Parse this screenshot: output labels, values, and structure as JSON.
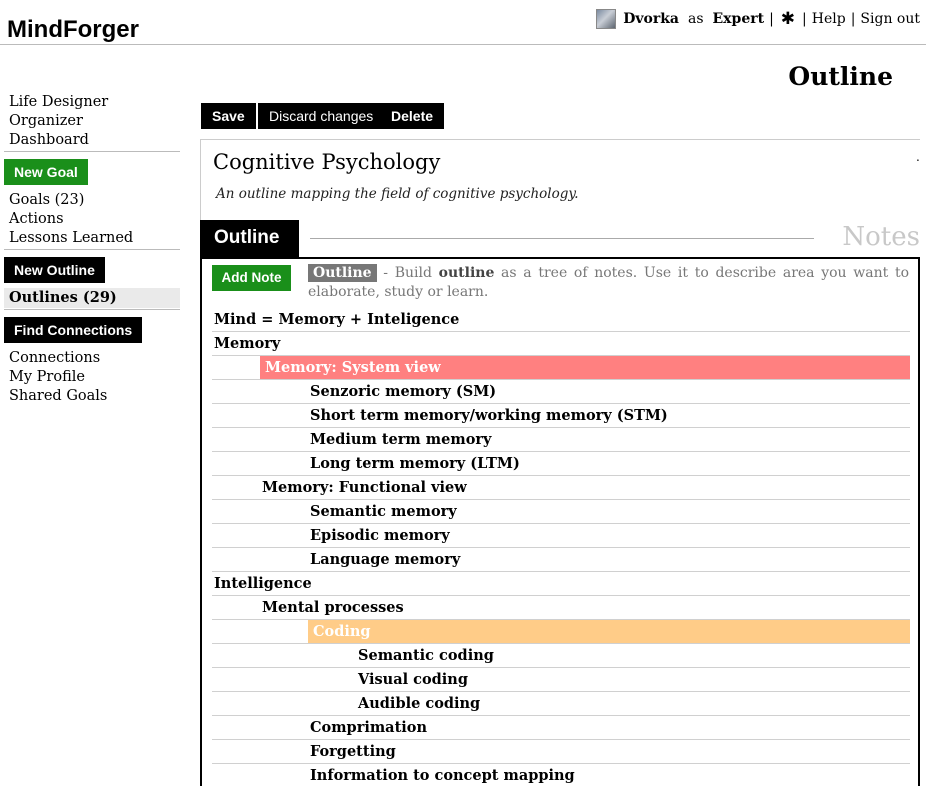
{
  "topbar": {
    "user": "Dvorka",
    "as_word": "as",
    "role": "Expert",
    "help": "Help",
    "signout": "Sign out"
  },
  "brand": "MindForger",
  "nav_top": [
    "Life Designer",
    "Organizer",
    "Dashboard"
  ],
  "new_goal": "New Goal",
  "nav_goals": [
    "Goals (23)",
    "Actions",
    "Lessons Learned"
  ],
  "new_outline": "New Outline",
  "outlines_selected": "Outlines (29)",
  "find_connections": "Find Connections",
  "nav_bottom": [
    "Connections",
    "My Profile",
    "Shared Goals"
  ],
  "page_title": "Outline",
  "toolbar": {
    "save": "Save",
    "discard": "Discard changes",
    "delete": "Delete"
  },
  "doc": {
    "title": "Cognitive Psychology",
    "description": "An outline mapping the field of cognitive psychology.",
    "dot": "."
  },
  "tabs": {
    "outline": "Outline",
    "notes": "Notes"
  },
  "add_note": "Add Note",
  "hint": {
    "tag": "Outline",
    "pre": " - Build ",
    "bold": "outline",
    "post": " as a tree of notes. Use it to describe area you want to elaborate, study or learn."
  },
  "tree": [
    {
      "text": "Mind = Memory + Inteligence",
      "level": 0
    },
    {
      "text": "Memory",
      "level": 0
    },
    {
      "text": "Memory: System view",
      "level": 1,
      "highlight": "red"
    },
    {
      "text": "Senzoric memory (SM)",
      "level": 2
    },
    {
      "text": "Short term memory/working memory (STM)",
      "level": 2
    },
    {
      "text": "Medium term memory",
      "level": 2
    },
    {
      "text": "Long term memory (LTM)",
      "level": 2
    },
    {
      "text": "Memory: Functional view",
      "level": 1
    },
    {
      "text": "Semantic memory",
      "level": 2
    },
    {
      "text": "Episodic memory",
      "level": 2
    },
    {
      "text": "Language memory",
      "level": 2
    },
    {
      "text": "Intelligence",
      "level": 0
    },
    {
      "text": "Mental processes",
      "level": 1
    },
    {
      "text": "Coding",
      "level": 2,
      "highlight": "orange"
    },
    {
      "text": "Semantic coding",
      "level": 3
    },
    {
      "text": "Visual coding",
      "level": 3
    },
    {
      "text": "Audible coding",
      "level": 3
    },
    {
      "text": "Comprimation",
      "level": 2
    },
    {
      "text": "Forgetting",
      "level": 2
    },
    {
      "text": "Information to concept mapping",
      "level": 2
    }
  ],
  "icons": {
    "avatar": "user-avatar",
    "settings": "gear-icon"
  },
  "colors": {
    "green": "#1a8f1a",
    "red_highlight": "#ff8080",
    "orange_highlight": "#ffcc88"
  }
}
